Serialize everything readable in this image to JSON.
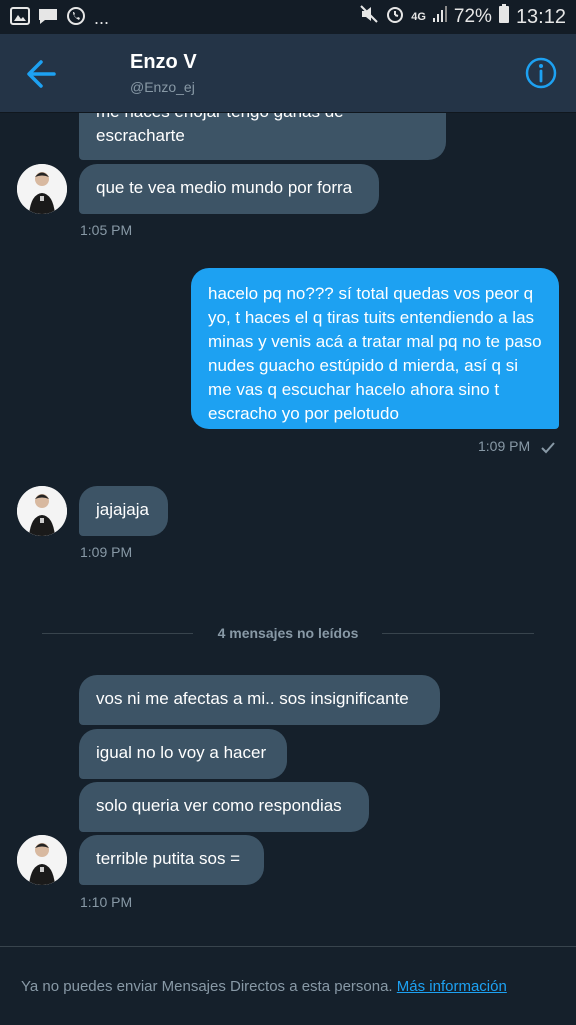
{
  "status_bar": {
    "more": "...",
    "network": "4G",
    "battery": "72%",
    "time": "13:12"
  },
  "header": {
    "name": "Enzo V",
    "handle": "@Enzo_ej"
  },
  "messages": [
    {
      "text": "me haces enojar tengo ganas de escracharte"
    },
    {
      "text": "que te vea medio mundo por forra"
    },
    {
      "text": "hacelo pq no??? sí total quedas vos peor q yo, t haces el q tiras tuits entendiendo a las minas y venis acá a tratar mal pq no te paso nudes guacho estúpido d mierda, así q si me vas q escuchar hacelo ahora sino t escracho yo por pelotudo"
    },
    {
      "text": "jajajaja"
    },
    {
      "text": "vos ni me afectas a mi.. sos insignificante"
    },
    {
      "text": "igual no lo voy a hacer"
    },
    {
      "text": "solo queria ver como respondias"
    },
    {
      "text": "terrible putita sos ="
    }
  ],
  "timestamps": {
    "t1": "1:05 PM",
    "t2": "1:09 PM",
    "t3": "1:09 PM",
    "t4": "1:10 PM"
  },
  "unread_divider": "4 mensajes no leídos",
  "footer": {
    "notice": "Ya no puedes enviar Mensajes Directos a esta persona.",
    "link": "Más información"
  },
  "colors": {
    "background": "#15202b",
    "header": "#243447",
    "incoming_bubble": "#3d5466",
    "outgoing_bubble": "#1da1f2",
    "accent": "#1da1f2",
    "muted_text": "#8899a6"
  },
  "icons": [
    "image-icon",
    "message-icon",
    "whatsapp-icon",
    "mute-icon",
    "alarm-icon",
    "signal-icon",
    "battery-icon",
    "back-arrow-icon",
    "info-icon",
    "read-check-icon",
    "avatar"
  ]
}
